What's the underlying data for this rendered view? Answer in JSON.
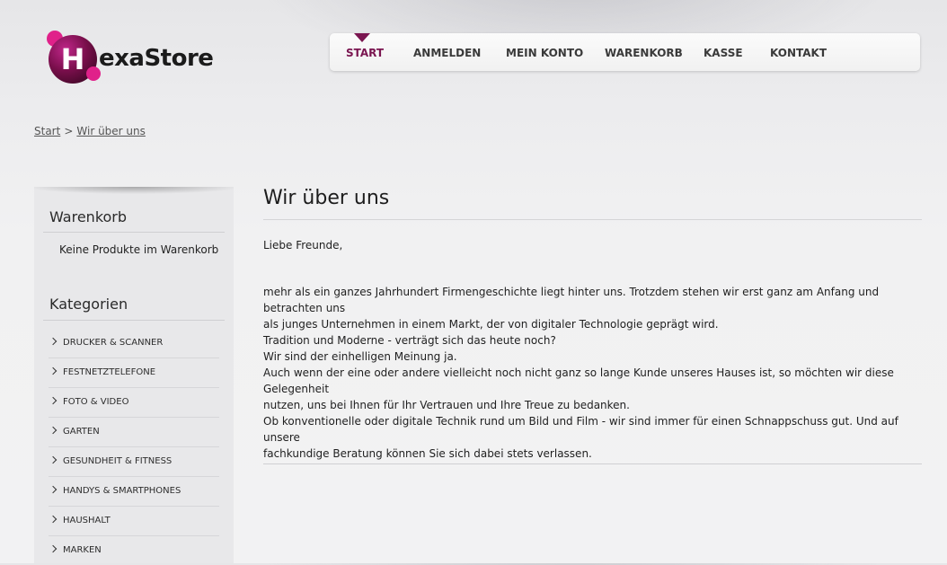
{
  "logo": {
    "initial": "H",
    "rest": "exaStore"
  },
  "nav": {
    "items": [
      {
        "label": "START"
      },
      {
        "label": "ANMELDEN"
      },
      {
        "label": "MEIN KONTO"
      },
      {
        "label": "WARENKORB"
      },
      {
        "label": "KASSE"
      },
      {
        "label": "KONTAKT"
      }
    ],
    "active_color": "#7a1550"
  },
  "breadcrumb": {
    "home": "Start",
    "separator": ">",
    "current": "Wir über uns"
  },
  "sidebar": {
    "cart": {
      "heading": "Warenkorb",
      "empty_text": "Keine Produkte im Warenkorb"
    },
    "categories": {
      "heading": "Kategorien",
      "items": [
        "DRUCKER & SCANNER",
        "FESTNETZTELEFONE",
        "FOTO & VIDEO",
        "GARTEN",
        "GESUNDHEIT & FITNESS",
        "HANDYS & SMARTPHONES",
        "HAUSHALT",
        "MARKEN"
      ]
    }
  },
  "main": {
    "title": "Wir über uns",
    "greeting": "Liebe Freunde,",
    "p1_line1": "mehr als ein ganzes Jahrhundert Firmengeschichte liegt hinter uns. Trotzdem stehen wir erst ganz am Anfang und betrachten uns",
    "p1_line2": "als junges Unternehmen in einem Markt, der von digitaler Technologie geprägt wird.",
    "p2_line1": "Tradition und Moderne - verträgt sich das heute noch?",
    "p2_line2": "Wir sind der einhelligen Meinung ja.",
    "p2_line3": "Auch wenn der eine oder andere vielleicht noch nicht ganz so lange Kunde unseres Hauses ist, so möchten wir diese Gelegenheit",
    "p2_line4": "nutzen, uns bei Ihnen für Ihr Vertrauen und Ihre Treue zu bedanken.",
    "p3_line1": "Ob konventionelle oder digitale Technik rund um Bild und Film - wir sind immer für einen Schnappschuss gut. Und auf unsere",
    "p3_line2": "fachkundige Beratung können Sie sich dabei stets verlassen."
  },
  "colors": {
    "brand": "#e0218a",
    "brand_dark": "#7a1550"
  }
}
